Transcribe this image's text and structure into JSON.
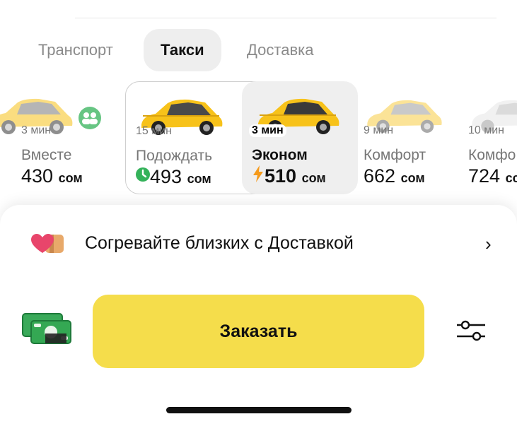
{
  "tabs": [
    {
      "label": "Транспорт"
    },
    {
      "label": "Такси"
    },
    {
      "label": "Доставка"
    }
  ],
  "tariffs": [
    {
      "eta": "3 мин",
      "name": "Вместе",
      "price": "430",
      "currency": "сом"
    },
    {
      "eta": "15 мин",
      "name": "Подождать",
      "price": "493",
      "currency": "сом"
    },
    {
      "eta": "3 мин",
      "name": "Эконом",
      "price": "510",
      "currency": "сом"
    },
    {
      "eta": "9 мин",
      "name": "Комфорт",
      "price": "662",
      "currency": "сом"
    },
    {
      "eta": "10 мин",
      "name": "Комфо",
      "price": "724",
      "currency": "сс"
    }
  ],
  "promo": {
    "text": "Согревайте близких с Доставкой",
    "chevron": "›"
  },
  "order_button": {
    "label": "Заказать"
  },
  "icons": {
    "promo": "hearts-gift-icon",
    "payment": "cash-icon",
    "settings": "sliders-icon",
    "clock": "clock-icon",
    "lightning": "lightning-icon"
  },
  "colors": {
    "accent": "#f5dd4b",
    "taxi_yellow": "#f7c21a",
    "clock_green": "#34b25a",
    "lightning_orange": "#f59a1b"
  }
}
